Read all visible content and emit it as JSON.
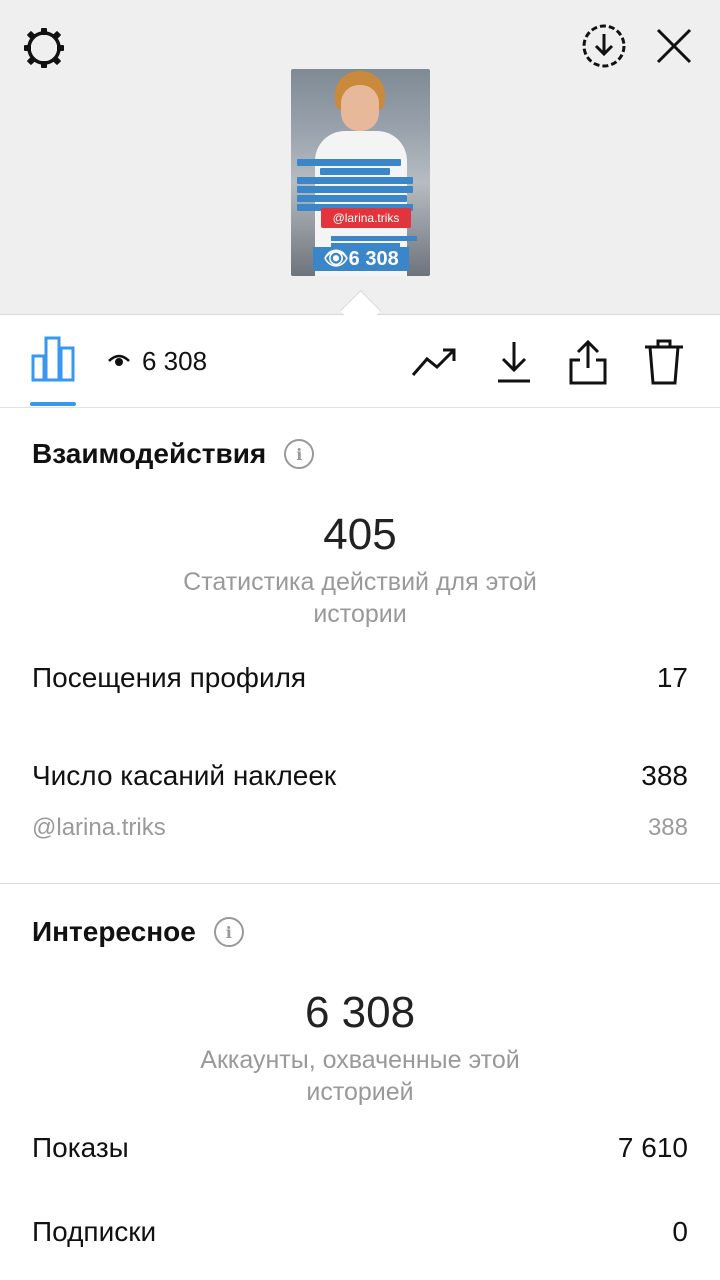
{
  "header": {
    "settings_icon": "gear-icon",
    "download_icon": "download-circle-icon",
    "close_icon": "close-icon"
  },
  "story_preview": {
    "mention": "@larina.triks",
    "views_overlay": "6 308"
  },
  "toolbar": {
    "views_count": "6 308",
    "tools": [
      "trend-icon",
      "download-icon",
      "share-icon",
      "trash-icon"
    ],
    "active_tab_color": "#3897f0"
  },
  "interactions": {
    "title": "Взаимодействия",
    "total": "405",
    "caption": "Статистика действий для этой истории",
    "rows": [
      {
        "label": "Посещения профиля",
        "value": "17"
      },
      {
        "label": "Число касаний наклеек",
        "value": "388"
      }
    ],
    "sub_row": {
      "label": "@larina.triks",
      "value": "388"
    }
  },
  "discovery": {
    "title": "Интересное",
    "total": "6 308",
    "caption": "Аккаунты, охваченные этой историей",
    "rows": [
      {
        "label": "Показы",
        "value": "7 610"
      },
      {
        "label": "Подписки",
        "value": "0"
      }
    ]
  }
}
